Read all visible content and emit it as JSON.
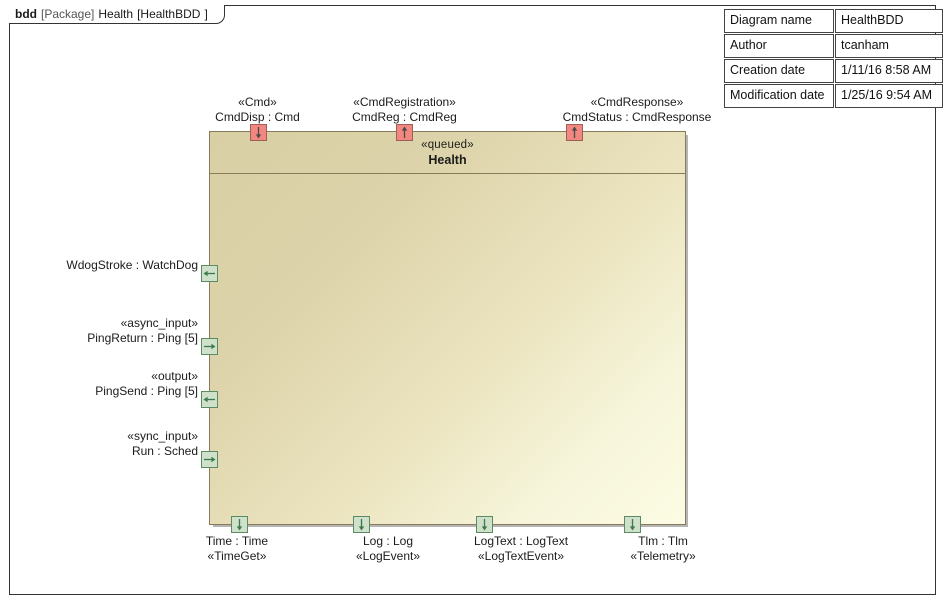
{
  "frame": {
    "kind": "bdd",
    "scope": "[Package]",
    "package": "Health",
    "bracket_open": "[",
    "diagram": "HealthBDD",
    "bracket_close": "]"
  },
  "info_table": {
    "rows": [
      {
        "label": "Diagram name",
        "value": "HealthBDD"
      },
      {
        "label": "Author",
        "value": "tcanham"
      },
      {
        "label": "Creation date",
        "value": "1/11/16 8:58 AM"
      },
      {
        "label": "Modification date",
        "value": "1/25/16 9:54 AM"
      }
    ]
  },
  "block": {
    "stereotype": "«queued»",
    "name": "Health",
    "fill_start": "#d9cfa4",
    "fill_end": "#fcfce4",
    "border_color": "#8a7a5c"
  },
  "ports": {
    "colors": {
      "flow_fill": "#f2877f",
      "flow_border": "#9c5f59",
      "iface_fill": "#cfe0cb",
      "iface_border": "#5e8a63",
      "arrow": "#4a4a4a",
      "iface_arrow": "#3d7a4a"
    },
    "top": [
      {
        "stereotype": "«Cmd»",
        "signature": "CmdDisp : Cmd",
        "icon": "arrow-down-icon",
        "kind": "flow"
      },
      {
        "stereotype": "«CmdRegistration»",
        "signature": "CmdReg : CmdReg",
        "icon": "arrow-up-icon",
        "kind": "flow"
      },
      {
        "stereotype": "«CmdResponse»",
        "signature": "CmdStatus : CmdResponse",
        "icon": "arrow-up-icon",
        "kind": "flow"
      }
    ],
    "left": [
      {
        "stereotype": "",
        "signature": "WdogStroke : WatchDog",
        "icon": "arrow-left-icon",
        "kind": "iface"
      },
      {
        "stereotype": "«async_input»",
        "signature": "PingReturn : Ping [5]",
        "icon": "arrow-right-icon",
        "kind": "iface"
      },
      {
        "stereotype": "«output»",
        "signature": "PingSend : Ping [5]",
        "icon": "arrow-left-icon",
        "kind": "iface"
      },
      {
        "stereotype": "«sync_input»",
        "signature": "Run : Sched",
        "icon": "arrow-right-icon",
        "kind": "iface"
      }
    ],
    "bottom": [
      {
        "signature": "Time : Time",
        "stereotype": "«TimeGet»",
        "icon": "arrow-down-icon",
        "kind": "iface"
      },
      {
        "signature": "Log : Log",
        "stereotype": "«LogEvent»",
        "icon": "arrow-down-icon",
        "kind": "iface"
      },
      {
        "signature": "LogText : LogText",
        "stereotype": "«LogTextEvent»",
        "icon": "arrow-down-icon",
        "kind": "iface"
      },
      {
        "signature": "Tlm : Tlm",
        "stereotype": "«Telemetry»",
        "icon": "arrow-down-icon",
        "kind": "iface"
      }
    ]
  }
}
